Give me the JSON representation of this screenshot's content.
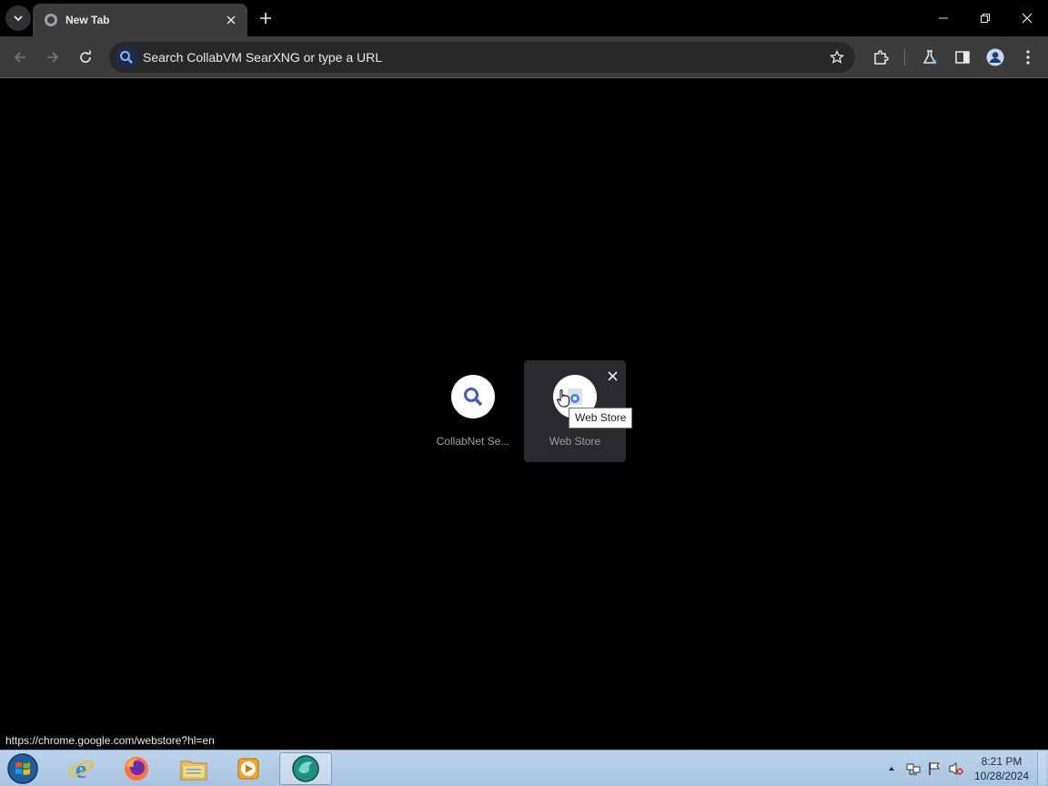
{
  "tabstrip": {
    "tabs": [
      {
        "title": "New Tab"
      }
    ]
  },
  "toolbar": {
    "omnibox_placeholder": "Search CollabVM SearXNG or type a URL"
  },
  "shortcuts": [
    {
      "label": "CollabNet Se...",
      "icon": "search-icon"
    },
    {
      "label": "Web Store",
      "icon": "web-store-icon"
    }
  ],
  "tooltip": "Web Store",
  "status_url": "https://chrome.google.com/webstore?hl=en",
  "taskbar": {
    "time": "8:21 PM",
    "date": "10/28/2024",
    "apps": [
      "internet-explorer-icon",
      "firefox-icon",
      "file-explorer-icon",
      "media-player-icon",
      "browser-icon"
    ]
  },
  "colors": {
    "accent": "#1a73e8",
    "toolbar": "#3c3c3c",
    "background": "#000000"
  }
}
